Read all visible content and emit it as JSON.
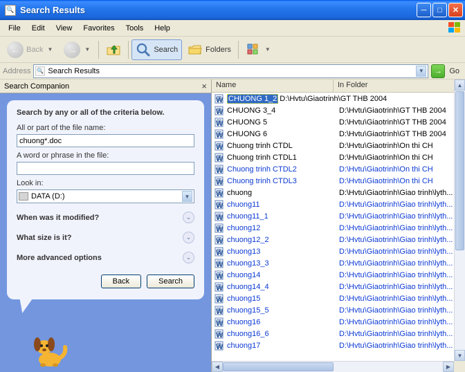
{
  "title": "Search Results",
  "menus": [
    "File",
    "Edit",
    "View",
    "Favorites",
    "Tools",
    "Help"
  ],
  "toolbar": {
    "back": "Back",
    "search": "Search",
    "folders": "Folders"
  },
  "address": {
    "label": "Address",
    "value": "Search Results",
    "go": "Go"
  },
  "companion": {
    "header": "Search Companion",
    "heading": "Search by any or all of the criteria below.",
    "filename_label": "All or part of the file name:",
    "filename_value": "chuong*.doc",
    "word_label": "A word or phrase in the file:",
    "word_value": "",
    "lookin_label": "Look in:",
    "lookin_value": "DATA (D:)",
    "modified": "When was it modified?",
    "size": "What size is it?",
    "advanced": "More advanced options",
    "back_btn": "Back",
    "search_btn": "Search"
  },
  "columns": {
    "name": "Name",
    "folder": "In Folder"
  },
  "results": [
    {
      "name": "CHUONG 1_2",
      "folder": "D:\\Hvtu\\Giaotrinh\\GT THB 2004",
      "selected": true
    },
    {
      "name": "CHUONG 3_4",
      "folder": "D:\\Hvtu\\Giaotrinh\\GT THB 2004"
    },
    {
      "name": "CHUONG 5",
      "folder": "D:\\Hvtu\\Giaotrinh\\GT THB 2004"
    },
    {
      "name": "CHUONG 6",
      "folder": "D:\\Hvtu\\Giaotrinh\\GT THB 2004"
    },
    {
      "name": "Chuong trinh CTDL",
      "folder": "D:\\Hvtu\\Giaotrinh\\On thi CH"
    },
    {
      "name": "Chuong trinh CTDL1",
      "folder": "D:\\Hvtu\\Giaotrinh\\On thi CH"
    },
    {
      "name": "Chuong trinh CTDL2",
      "folder": "D:\\Hvtu\\Giaotrinh\\On thi CH",
      "blue": true
    },
    {
      "name": "Chuong trinh CTDL3",
      "folder": "D:\\Hvtu\\Giaotrinh\\On thi CH",
      "blue": true
    },
    {
      "name": "chuong",
      "folder": "D:\\Hvtu\\Giaotrinh\\Giao trinh\\lyth..."
    },
    {
      "name": "chuong11",
      "folder": "D:\\Hvtu\\Giaotrinh\\Giao trinh\\lyth...",
      "blue": true
    },
    {
      "name": "chuong11_1",
      "folder": "D:\\Hvtu\\Giaotrinh\\Giao trinh\\lyth...",
      "blue": true
    },
    {
      "name": "chuong12",
      "folder": "D:\\Hvtu\\Giaotrinh\\Giao trinh\\lyth...",
      "blue": true
    },
    {
      "name": "chuong12_2",
      "folder": "D:\\Hvtu\\Giaotrinh\\Giao trinh\\lyth...",
      "blue": true
    },
    {
      "name": "chuong13",
      "folder": "D:\\Hvtu\\Giaotrinh\\Giao trinh\\lyth...",
      "blue": true
    },
    {
      "name": "chuong13_3",
      "folder": "D:\\Hvtu\\Giaotrinh\\Giao trinh\\lyth...",
      "blue": true
    },
    {
      "name": "chuong14",
      "folder": "D:\\Hvtu\\Giaotrinh\\Giao trinh\\lyth...",
      "blue": true
    },
    {
      "name": "chuong14_4",
      "folder": "D:\\Hvtu\\Giaotrinh\\Giao trinh\\lyth...",
      "blue": true
    },
    {
      "name": "chuong15",
      "folder": "D:\\Hvtu\\Giaotrinh\\Giao trinh\\lyth...",
      "blue": true
    },
    {
      "name": "chuong15_5",
      "folder": "D:\\Hvtu\\Giaotrinh\\Giao trinh\\lyth...",
      "blue": true
    },
    {
      "name": "chuong16",
      "folder": "D:\\Hvtu\\Giaotrinh\\Giao trinh\\lyth...",
      "blue": true
    },
    {
      "name": "chuong16_6",
      "folder": "D:\\Hvtu\\Giaotrinh\\Giao trinh\\lyth...",
      "blue": true
    },
    {
      "name": "chuong17",
      "folder": "D:\\Hvtu\\Giaotrinh\\Giao trinh\\lyth...",
      "blue": true
    }
  ]
}
